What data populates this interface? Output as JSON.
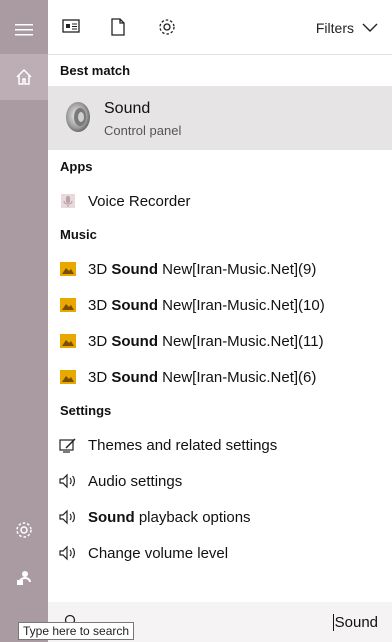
{
  "topbar": {
    "filters_label": "Filters"
  },
  "sections": {
    "best_match": "Best match",
    "apps": "Apps",
    "music": "Music",
    "settings": "Settings"
  },
  "best_match": {
    "title": "Sound",
    "subtitle": "Control panel"
  },
  "apps": [
    {
      "label": "Voice Recorder"
    }
  ],
  "music": [
    {
      "prefix": "3D ",
      "bold": "Sound",
      "suffix": " New[Iran-Music.Net](9)"
    },
    {
      "prefix": "3D ",
      "bold": "Sound",
      "suffix": " New[Iran-Music.Net](10)"
    },
    {
      "prefix": "3D ",
      "bold": "Sound",
      "suffix": " New[Iran-Music.Net](11)"
    },
    {
      "prefix": "3D ",
      "bold": "Sound",
      "suffix": " New[Iran-Music.Net](6)"
    }
  ],
  "settings": [
    {
      "label": "Themes and related settings"
    },
    {
      "label": "Audio settings"
    },
    {
      "bold": "Sound",
      "suffix": " playback options"
    },
    {
      "label": "Change volume level"
    }
  ],
  "search": {
    "query": "Sound",
    "tooltip": "Type here to search"
  },
  "icons": {
    "menu": "hamburger-icon",
    "home": "home-icon",
    "settings": "gear-icon",
    "feedback": "feedback-icon",
    "documents_tab": "documents-icon",
    "file_tab": "file-icon",
    "settings_tab": "gear-icon"
  },
  "colors": {
    "rail": "#aa9ba2",
    "selected": "#e7e4e5",
    "folder": "#e8a800"
  }
}
